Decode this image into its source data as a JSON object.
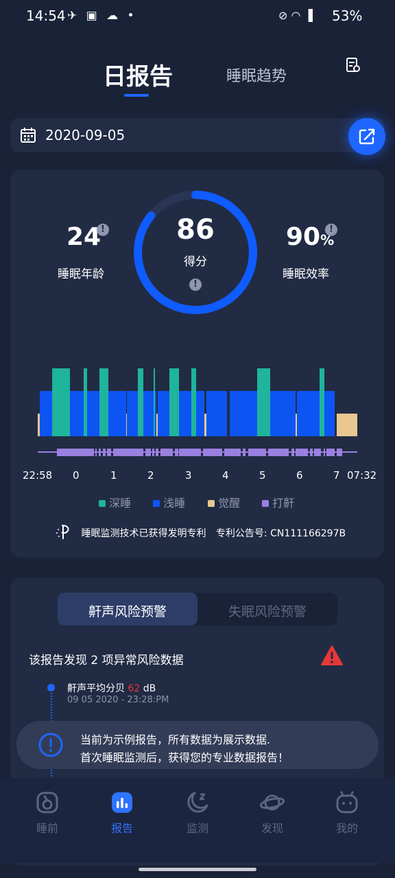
{
  "status_bar": {
    "time": "14:54",
    "left_icons": "✈ ▣ ☁ •",
    "right_icons": "⊘ ◠ ▐",
    "battery": "53%"
  },
  "header": {
    "tabs": [
      {
        "label": "日报告",
        "active": true
      },
      {
        "label": "睡眠趋势",
        "active": false
      }
    ],
    "doc_icon": "report-doc-icon"
  },
  "date_bar": {
    "date": "2020-09-05",
    "calendar_icon": "calendar-icon",
    "share_icon": "share-icon"
  },
  "summary": {
    "sleep_age_value": "24",
    "sleep_age_label": "睡眠年龄",
    "score_value": "86",
    "score_label": "得分",
    "score_fraction": 0.86,
    "efficiency_value": "90",
    "efficiency_unit": "%",
    "efficiency_label": "睡眠效率",
    "info_mark": "!"
  },
  "chart_data": {
    "type": "bar",
    "x_start_label": "22:58",
    "x_end_label": "07:32",
    "tick_labels": [
      "0",
      "1",
      "2",
      "3",
      "4",
      "5",
      "6",
      "7"
    ],
    "legend": [
      {
        "name": "深睡",
        "color": "#1fb49c"
      },
      {
        "name": "浅睡",
        "color": "#0d55f3"
      },
      {
        "name": "觉醒",
        "color": "#e8c890"
      },
      {
        "name": "打鼾",
        "color": "#9a80e0"
      }
    ]
  },
  "patent": {
    "text": "睡眠监测技术已获得发明专利",
    "number_label": "专利公告号: CN111166297B"
  },
  "risk": {
    "tabs": [
      "鼾声风险预警",
      "失眠风险预警"
    ],
    "summary": "该报告发现 2 项异常风险数据",
    "items": [
      {
        "title_prefix": "鼾声平均分贝 ",
        "value": "62",
        "unit": " dB",
        "time": "09 05 2020  - 23:28:PM"
      }
    ]
  },
  "toast": {
    "line1": "当前为示例报告，所有数据为展示数据.",
    "line2": "首次睡眠监测后，获得您的专业数据报告！"
  },
  "bottom_nav": [
    {
      "label": "睡前",
      "icon": "sleep-prep-icon",
      "active": false
    },
    {
      "label": "报告",
      "icon": "report-chart-icon",
      "active": true
    },
    {
      "label": "监测",
      "icon": "moon-monitor-icon",
      "active": false
    },
    {
      "label": "发现",
      "icon": "planet-discover-icon",
      "active": false
    },
    {
      "label": "我的",
      "icon": "profile-icon",
      "active": false
    }
  ],
  "colors": {
    "background": "#1a2238",
    "card": "#222b44",
    "accent": "#1e66ff",
    "alert": "#e53935"
  }
}
